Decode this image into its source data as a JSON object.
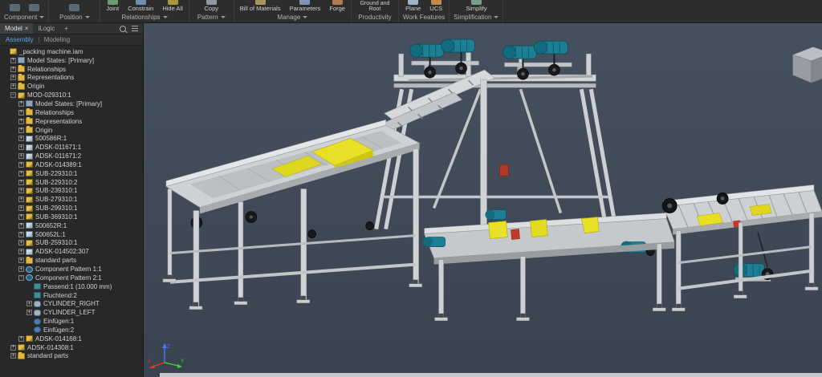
{
  "ribbon": {
    "groups": [
      {
        "label": "Component",
        "dropdown": true,
        "buttons": [
          {
            "label": "",
            "icon": "place-icon"
          },
          {
            "label": "",
            "icon": "create-icon"
          }
        ]
      },
      {
        "label": "Position",
        "dropdown": true,
        "buttons": [
          {
            "label": "",
            "icon": "position-icon"
          }
        ]
      },
      {
        "label": "Relationships",
        "dropdown": true,
        "buttons": [
          {
            "label": "Joint",
            "icon": "joint-icon"
          },
          {
            "label": "Constrain",
            "icon": "constrain-icon"
          },
          {
            "label": "Hide All",
            "icon": "hide-all-icon"
          }
        ]
      },
      {
        "label": "Pattern",
        "dropdown": true,
        "buttons": [
          {
            "label": "Copy",
            "icon": "copy-icon"
          }
        ]
      },
      {
        "label": "Manage",
        "dropdown": true,
        "buttons": [
          {
            "label": "Bill of Materials",
            "icon": "bom-icon"
          },
          {
            "label": "Parameters",
            "icon": "parameters-icon"
          },
          {
            "label": "Forge",
            "icon": "forge-icon"
          }
        ]
      },
      {
        "label": "Productivity",
        "dropdown": false,
        "buttons": [
          {
            "label": "Ground and Root",
            "icon": "ground-root-icon"
          }
        ]
      },
      {
        "label": "Work Features",
        "dropdown": false,
        "buttons": [
          {
            "label": "Plane",
            "icon": "plane-icon"
          },
          {
            "label": "UCS",
            "icon": "ucs-icon"
          }
        ]
      },
      {
        "label": "Simplification",
        "dropdown": true,
        "buttons": [
          {
            "label": "Simplify",
            "icon": "simplify-icon"
          }
        ]
      }
    ]
  },
  "browser": {
    "tabs": [
      {
        "label": "Model",
        "active": true,
        "close_glyph": "×"
      },
      {
        "label": "iLogic"
      },
      {
        "label": "+"
      }
    ],
    "subtabs": [
      {
        "label": "Assembly",
        "active": true
      },
      {
        "label": "Modeling",
        "active": false
      }
    ],
    "tree": {
      "items": [
        {
          "label": "_packing machine.iam",
          "level": 0,
          "exp": "",
          "icon": "assembly"
        },
        {
          "label": "Model States: [Primary]",
          "level": 1,
          "exp": "+",
          "icon": "model-states"
        },
        {
          "label": "Relationships",
          "level": 1,
          "exp": "+",
          "icon": "folder"
        },
        {
          "label": "Representations",
          "level": 1,
          "exp": "+",
          "icon": "folder"
        },
        {
          "label": "Origin",
          "level": 1,
          "exp": "+",
          "icon": "folder"
        },
        {
          "label": "MOD-029310:1",
          "level": 1,
          "exp": "-",
          "icon": "assembly"
        },
        {
          "label": "Model States: [Primary]",
          "level": 2,
          "exp": "+",
          "icon": "model-states"
        },
        {
          "label": "Relationships",
          "level": 2,
          "exp": "+",
          "icon": "folder"
        },
        {
          "label": "Representations",
          "level": 2,
          "exp": "+",
          "icon": "folder"
        },
        {
          "label": "Origin",
          "level": 2,
          "exp": "+",
          "icon": "folder"
        },
        {
          "label": "500586R:1",
          "level": 2,
          "exp": "+",
          "icon": "part"
        },
        {
          "label": "ADSK-011671:1",
          "level": 2,
          "exp": "+",
          "icon": "part"
        },
        {
          "label": "ADSK-011671:2",
          "level": 2,
          "exp": "+",
          "icon": "part"
        },
        {
          "label": "ADSK-014389:1",
          "level": 2,
          "exp": "+",
          "icon": "assembly"
        },
        {
          "label": "SUB-229310:1",
          "level": 2,
          "exp": "+",
          "icon": "assembly"
        },
        {
          "label": "SUB-229310:2",
          "level": 2,
          "exp": "+",
          "icon": "assembly"
        },
        {
          "label": "SUB-239310:1",
          "level": 2,
          "exp": "+",
          "icon": "assembly"
        },
        {
          "label": "SUB-279310:1",
          "level": 2,
          "exp": "+",
          "icon": "assembly"
        },
        {
          "label": "SUB-299310:1",
          "level": 2,
          "exp": "+",
          "icon": "assembly"
        },
        {
          "label": "SUB-369310:1",
          "level": 2,
          "exp": "+",
          "icon": "assembly"
        },
        {
          "label": "500652R:1",
          "level": 2,
          "exp": "+",
          "icon": "part"
        },
        {
          "label": "500652L:1",
          "level": 2,
          "exp": "+",
          "icon": "part"
        },
        {
          "label": "SUB-259310:1",
          "level": 2,
          "exp": "+",
          "icon": "assembly"
        },
        {
          "label": "ADSK-014502:307",
          "level": 2,
          "exp": "+",
          "icon": "part"
        },
        {
          "label": "standard parts",
          "level": 2,
          "exp": "+",
          "icon": "folder"
        },
        {
          "label": "Component Pattern 1:1",
          "level": 2,
          "exp": "+",
          "icon": "pattern"
        },
        {
          "label": "Component Pattern 2:1",
          "level": 2,
          "exp": "-",
          "icon": "pattern"
        },
        {
          "label": "Passend:1 (10.000 mm)",
          "level": 3,
          "exp": "",
          "icon": "mate"
        },
        {
          "label": "Fluchtend:2",
          "level": 3,
          "exp": "",
          "icon": "flush"
        },
        {
          "label": "CYLINDER_RIGHT",
          "level": 3,
          "exp": "+",
          "icon": "cylinder"
        },
        {
          "label": "CYLINDER_LEFT",
          "level": 3,
          "exp": "+",
          "icon": "cylinder"
        },
        {
          "label": "Einfügen:1",
          "level": 3,
          "exp": "",
          "icon": "insert"
        },
        {
          "label": "Einfügen:2",
          "level": 3,
          "exp": "",
          "icon": "insert"
        },
        {
          "label": "ADSK-014168:1",
          "level": 2,
          "exp": "+",
          "icon": "assembly"
        },
        {
          "label": "ADSK-014308:1",
          "level": 1,
          "exp": "+",
          "icon": "assembly"
        },
        {
          "label": "standard parts",
          "level": 1,
          "exp": "+",
          "icon": "folder"
        }
      ]
    }
  },
  "viewport": {
    "background": "#3e4857",
    "axes": [
      {
        "label": "X",
        "color": "#e8392b"
      },
      {
        "label": "Y",
        "color": "#3fd43f"
      },
      {
        "label": "Z",
        "color": "#4a78ff"
      }
    ],
    "machine_colors": {
      "steel": "#ced1d3",
      "accent_yellow": "#e8e128",
      "motor_teal": "#1d7f95",
      "detail_red": "#bf3a2c"
    }
  }
}
